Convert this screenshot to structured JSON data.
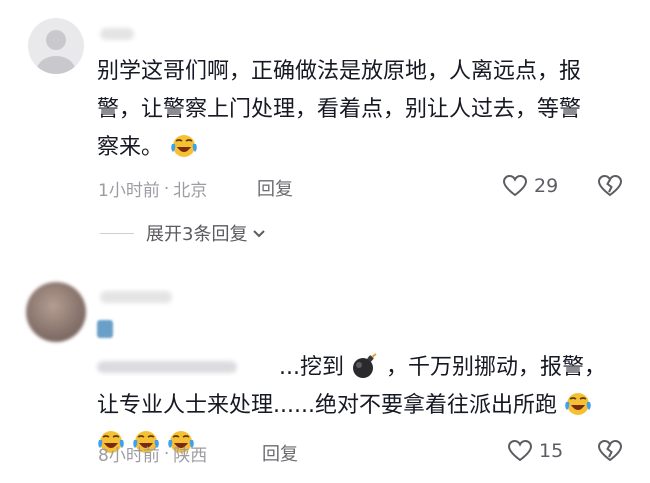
{
  "comments": [
    {
      "username": "",
      "lines": [
        "别学这哥们啊，正确做法是放原地，人离远点，报",
        "警，让警察上门处理，看着点，别让人过去，等警",
        "察来。"
      ],
      "time": "1小时前",
      "location": "北京",
      "reply_label": "回复",
      "likes": "29",
      "expand_label": "展开3条回复"
    },
    {
      "username": "",
      "reply_to": "",
      "line1_text": "...挖到",
      "line1_rest": "，千万别挪动，报警，",
      "line2": "让专业人士来处理......绝对不要拿着往派出所跑",
      "time": "8小时前",
      "location": "陕西",
      "reply_label": "回复",
      "likes": "15"
    }
  ],
  "icons": {
    "avatar_default": "default-avatar-icon",
    "laugh_cry": "laugh-cry-emoji",
    "bomb": "bomb-emoji",
    "heart": "heart-outline-icon",
    "broken_heart": "broken-heart-icon",
    "chevron": "chevron-down-icon"
  },
  "colors": {
    "text": "#161823",
    "meta": "#9c9ca3",
    "emoji_face": "#f6c033"
  }
}
